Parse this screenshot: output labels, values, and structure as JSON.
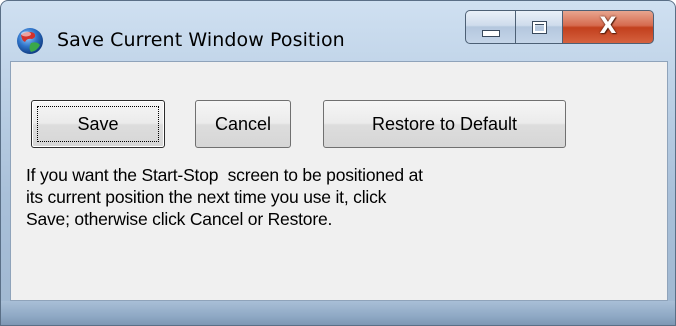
{
  "window": {
    "title": "Save Current Window Position",
    "icon": "globe-app-icon"
  },
  "caption": {
    "minimize_icon": "minimize-icon",
    "maximize_icon": "maximize-icon",
    "close_label": "X"
  },
  "buttons": {
    "save_label": "Save",
    "cancel_label": "Cancel",
    "restore_label": "Restore to Default"
  },
  "message": {
    "lines": [
      "If you want the Start-Stop  screen to be positioned at",
      "its current position the next time you use it, click",
      "Save; otherwise click Cancel or Restore."
    ]
  },
  "colors": {
    "frame": "#b8cde3",
    "client": "#f0f0f0",
    "close_button": "#c2401d"
  }
}
